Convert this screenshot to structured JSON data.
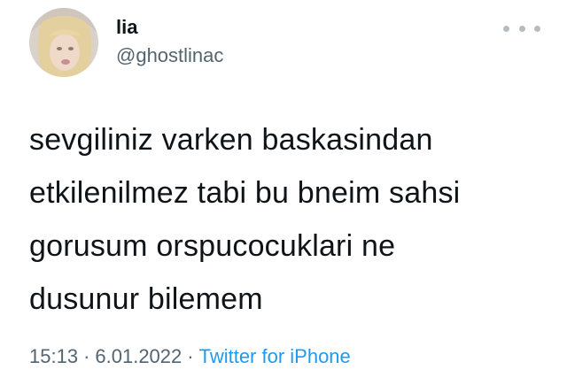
{
  "author": {
    "display_name": "lia",
    "handle": "@ghostlinac",
    "avatar_icon": "profile-photo-avatar"
  },
  "menu": {
    "more_icon": "more-horizontal-icon"
  },
  "tweet": {
    "lines": [
      "sevgiliniz varken baskasindan",
      "etkilenilmez tabi bu bneim sahsi",
      "gorusum orspucocuklari ne",
      "dusunur bilemem"
    ]
  },
  "meta": {
    "time": "15:13",
    "separator": "·",
    "date": "6.01.2022",
    "source": "Twitter for iPhone"
  },
  "colors": {
    "text": "#0f1419",
    "secondary": "#536471",
    "link": "#1d9bf0"
  }
}
